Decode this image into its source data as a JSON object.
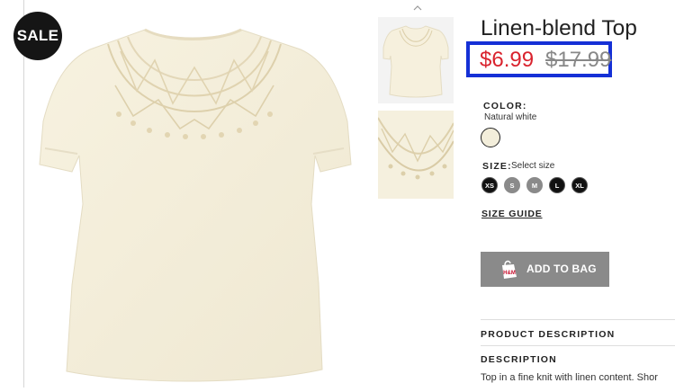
{
  "badge": {
    "label": "SALE"
  },
  "product": {
    "title": "Linen-blend Top",
    "sale_price": "$6.99",
    "original_price": "$17.99",
    "highlight_color": "#1530d6",
    "sale_price_color": "#d9232e"
  },
  "color": {
    "label": "COLOR:",
    "value": "Natural white",
    "swatch_color": "#f3eedb"
  },
  "size": {
    "label": "SIZE:",
    "hint": "Select size",
    "options": [
      "XS",
      "S",
      "M",
      "L",
      "XL"
    ],
    "available": [
      true,
      false,
      false,
      true,
      true
    ]
  },
  "size_guide": {
    "label": "SIZE GUIDE"
  },
  "add_to_bag": {
    "label": "ADD TO BAG",
    "icon": "shopping-bag-icon",
    "icon_text": "H&M"
  },
  "product_description": {
    "label": "PRODUCT DESCRIPTION"
  },
  "description": {
    "label": "DESCRIPTION",
    "text": "Top in a fine knit with linen content. Shor",
    "text_line2": "..."
  },
  "gallery": {
    "nav_icon": "chevron-up-icon",
    "thumbnails": [
      "front-view",
      "detail-view"
    ]
  }
}
